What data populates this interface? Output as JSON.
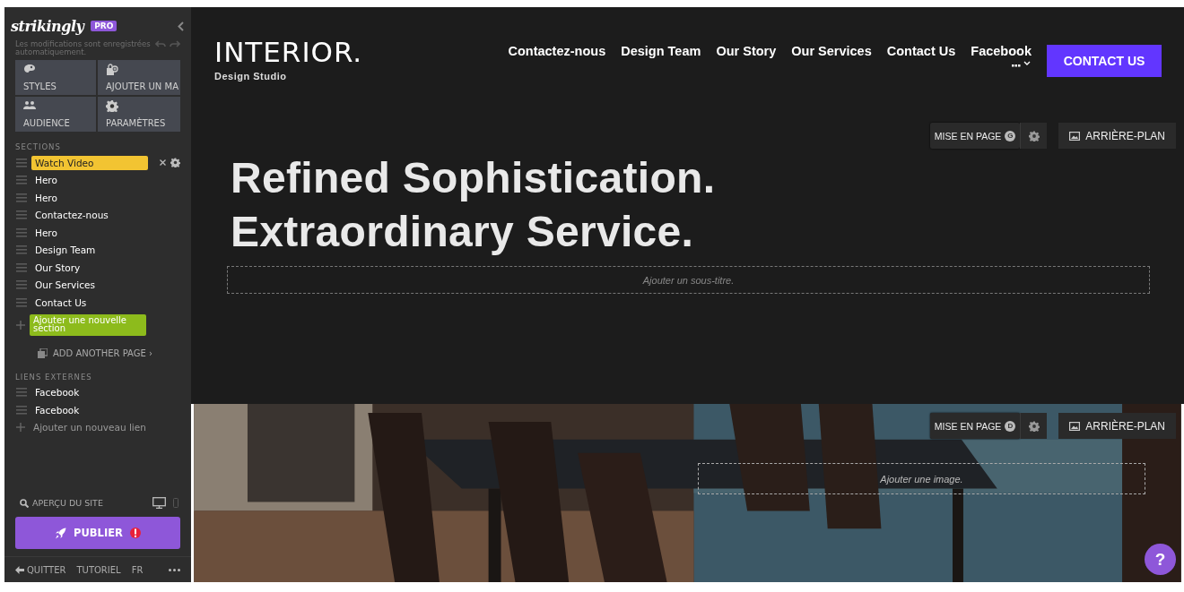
{
  "sidebar": {
    "logo": "strikingly",
    "badge": "PRO",
    "autosave_note": "Les modifications sont enregistrées automatiquement.",
    "tools": [
      {
        "kind": "palette",
        "label": "STYLES"
      },
      {
        "kind": "bag",
        "label": "AJOUTER UN MA"
      },
      {
        "kind": "people",
        "label": "AUDIENCE"
      },
      {
        "kind": "gear",
        "label": "PARAMÈTRES"
      }
    ],
    "sections_heading": "SECTIONS",
    "sections": [
      {
        "label": "Watch Video",
        "selected": true
      },
      {
        "label": "Hero",
        "selected": false
      },
      {
        "label": "Hero",
        "selected": false
      },
      {
        "label": "Contactez-nous",
        "selected": false
      },
      {
        "label": "Hero",
        "selected": false
      },
      {
        "label": "Design Team",
        "selected": false
      },
      {
        "label": "Our Story",
        "selected": false
      },
      {
        "label": "Our Services",
        "selected": false
      },
      {
        "label": "Contact Us",
        "selected": false
      }
    ],
    "add_section": "Ajouter une nouvelle section",
    "add_page": "ADD ANOTHER PAGE ›",
    "external_heading": "LIENS EXTERNES",
    "external_links": [
      {
        "label": "Facebook"
      },
      {
        "label": "Facebook"
      }
    ],
    "add_link": "Ajouter un nouveau lien",
    "preview": "APERÇU DU SITE",
    "publish": "PUBLIER",
    "footer": [
      {
        "kind": "quit",
        "label": "QUITTER"
      },
      {
        "kind": "plain",
        "label": "TUTORIEL"
      },
      {
        "kind": "plain",
        "label": "FR"
      }
    ]
  },
  "site": {
    "brand": "INTERIOR.",
    "brand_sub": "Design Studio",
    "nav": [
      {
        "label": "Contactez-nous"
      },
      {
        "label": "Design Team"
      },
      {
        "label": "Our Story"
      },
      {
        "label": "Our Services"
      },
      {
        "label": "Contact Us"
      },
      {
        "label": "Facebook"
      }
    ],
    "cta": "CONTACT US",
    "sections": [
      {
        "kind": "text",
        "layout_label": "MISE EN PAGE",
        "layout_key": "G",
        "background_label": "ARRIÈRE-PLAN",
        "title_lines": [
          "Refined Sophistication.",
          "Extraordinary Service."
        ],
        "placeholder": "Ajouter un sous-titre."
      },
      {
        "kind": "picture",
        "layout_label": "MISE EN PAGE",
        "layout_key": "D",
        "background_label": "ARRIÈRE-PLAN",
        "placeholder": "Ajouter une image."
      }
    ],
    "help": "?"
  }
}
